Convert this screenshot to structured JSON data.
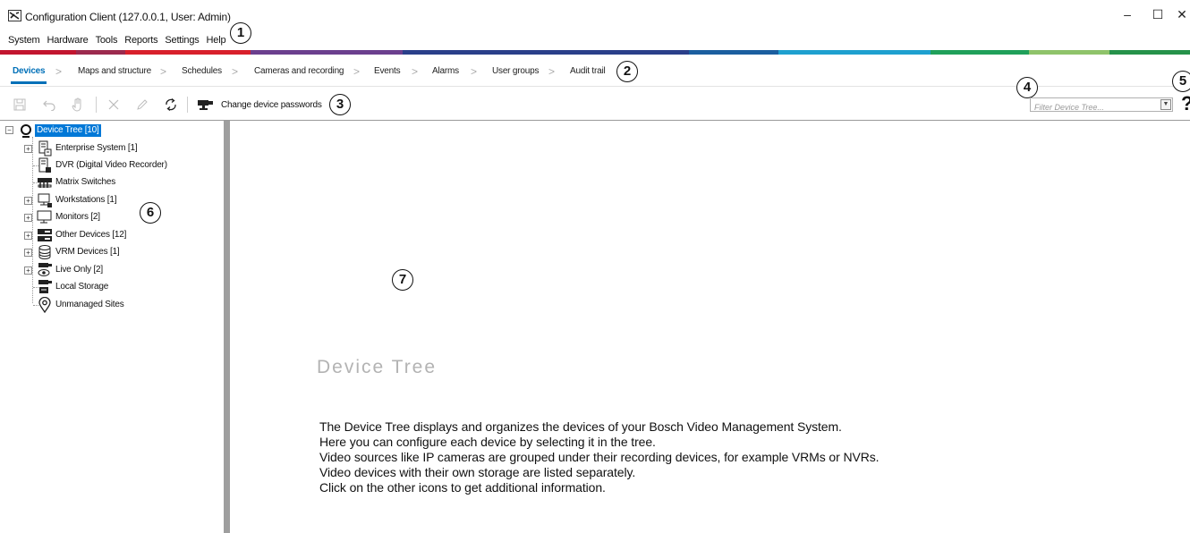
{
  "window": {
    "title": "Configuration Client (127.0.0.1, User: Admin)",
    "minimize": "–",
    "maximize": "☐",
    "close": "✕"
  },
  "menu": [
    "System",
    "Hardware",
    "Tools",
    "Reports",
    "Settings",
    "Help"
  ],
  "accent_colors": [
    "#c2152f",
    "#9c2a4e",
    "#d8202b",
    "#6b3f8e",
    "#2a3f8a",
    "#1b5e9f",
    "#1ea0cf",
    "#20a05a",
    "#8fc36a",
    "#26924a"
  ],
  "workflow": {
    "tabs": [
      "Devices",
      "Maps and structure",
      "Schedules",
      "Cameras and recording",
      "Events",
      "Alarms",
      "User groups",
      "Audit trail"
    ],
    "active": "Devices",
    "separator": ">"
  },
  "toolbar": {
    "icons": [
      "save-icon",
      "undo-icon",
      "hand-icon",
      "delete-icon",
      "edit-icon",
      "refresh-icon",
      "camera-password-icon"
    ],
    "change_passwords_label": "Change device passwords"
  },
  "filter": {
    "placeholder": "Filter Device Tree..."
  },
  "help": {
    "label": "?"
  },
  "tree": {
    "root": "Device Tree [10]",
    "items": [
      {
        "label": "Enterprise System [1]",
        "icon": "enterprise-icon",
        "expandable": true
      },
      {
        "label": "DVR (Digital Video Recorder)",
        "icon": "dvr-icon",
        "expandable": false
      },
      {
        "label": "Matrix Switches",
        "icon": "matrix-icon",
        "expandable": false
      },
      {
        "label": "Workstations [1]",
        "icon": "workstation-icon",
        "expandable": true
      },
      {
        "label": "Monitors [2]",
        "icon": "monitor-icon",
        "expandable": true
      },
      {
        "label": "Other Devices [12]",
        "icon": "other-devices-icon",
        "expandable": true
      },
      {
        "label": "VRM Devices [1]",
        "icon": "vrm-icon",
        "expandable": true
      },
      {
        "label": "Live Only [2]",
        "icon": "live-only-icon",
        "expandable": true
      },
      {
        "label": "Local Storage",
        "icon": "local-storage-icon",
        "expandable": false
      },
      {
        "label": "Unmanaged Sites",
        "icon": "unmanaged-sites-icon",
        "expandable": false
      }
    ]
  },
  "content": {
    "title": "Device Tree",
    "lines": [
      "The Device Tree displays and organizes the devices of your Bosch Video Management System.",
      "Here you can configure each device by selecting it in the tree.",
      "Video sources like IP cameras are grouped under their recording devices, for example VRMs or NVRs.",
      "Video devices with their own storage are listed separately.",
      "Click on the other icons to get additional information."
    ]
  },
  "callouts": [
    "1",
    "2",
    "3",
    "4",
    "5",
    "6",
    "7"
  ]
}
